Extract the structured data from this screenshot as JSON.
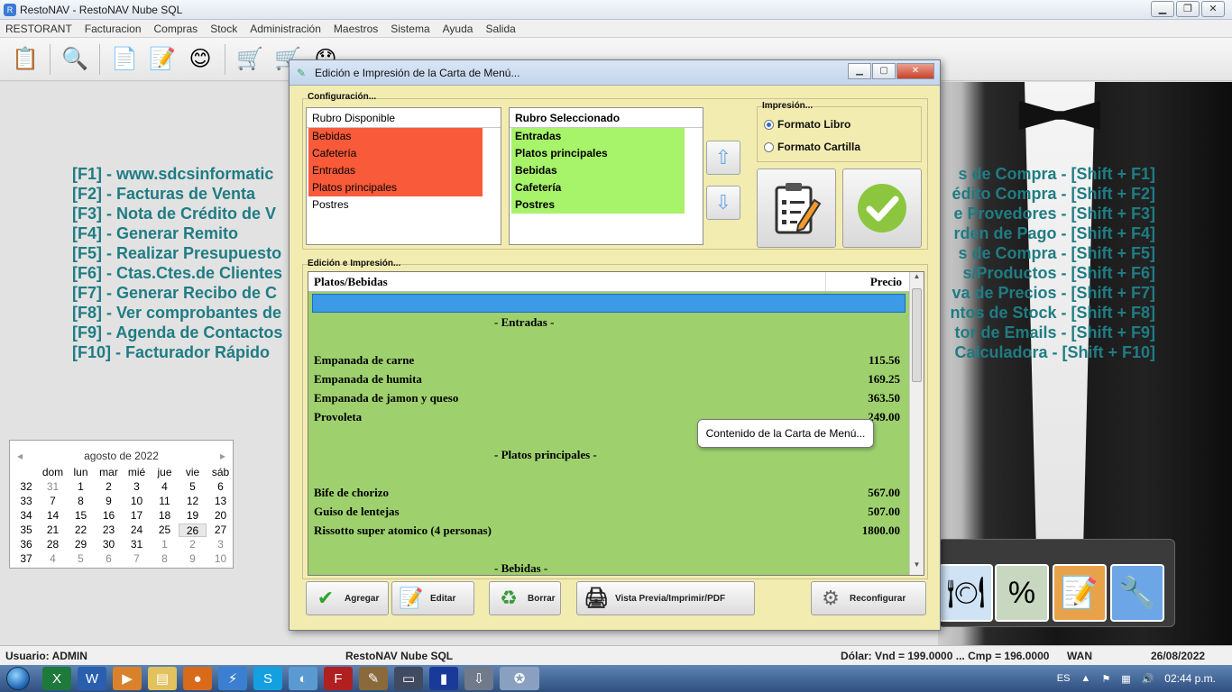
{
  "app": {
    "title": "RestoNAV - RestoNAV Nube SQL"
  },
  "menu": [
    "RESTORANT",
    "Facturacion",
    "Compras",
    "Stock",
    "Administración",
    "Maestros",
    "Sistema",
    "Ayuda",
    "Salida"
  ],
  "shortcuts_left": [
    "[F1] - www.sdcsinformatic",
    "[F2] - Facturas de Venta",
    "[F3] - Nota de Crédito de V",
    "[F4] - Generar Remito",
    "[F5] - Realizar Presupuesto",
    "[F6] - Ctas.Ctes.de Clientes",
    "[F7] - Generar Recibo de C",
    "[F8] - Ver comprobantes de",
    "[F9] - Agenda de Contactos",
    "[F10] - Facturador Rápido"
  ],
  "shortcuts_right": [
    "s de Compra - [Shift + F1]",
    "édito Compra - [Shift + F2]",
    "e Provedores - [Shift + F3]",
    "rden de Pago - [Shift + F4]",
    "s de Compra - [Shift + F5]",
    "s/Productos - [Shift + F6]",
    "va de Precios - [Shift + F7]",
    "ntos de Stock - [Shift + F8]",
    "tor de Emails - [Shift + F9]",
    "Calculadora - [Shift + F10]"
  ],
  "calendar": {
    "title": "agosto de 2022",
    "weekdays": [
      "dom",
      "lun",
      "mar",
      "mié",
      "jue",
      "vie",
      "sáb"
    ],
    "weeks": [
      {
        "wk": "32",
        "days": [
          "31",
          "1",
          "2",
          "3",
          "4",
          "5",
          "6"
        ]
      },
      {
        "wk": "33",
        "days": [
          "7",
          "8",
          "9",
          "10",
          "11",
          "12",
          "13"
        ]
      },
      {
        "wk": "34",
        "days": [
          "14",
          "15",
          "16",
          "17",
          "18",
          "19",
          "20"
        ]
      },
      {
        "wk": "35",
        "days": [
          "21",
          "22",
          "23",
          "24",
          "25",
          "26",
          "27"
        ]
      },
      {
        "wk": "36",
        "days": [
          "28",
          "29",
          "30",
          "31",
          "1",
          "2",
          "3"
        ]
      },
      {
        "wk": "37",
        "days": [
          "4",
          "5",
          "6",
          "7",
          "8",
          "9",
          "10"
        ]
      }
    ]
  },
  "dialog": {
    "title": "Edición e Impresión de la Carta de Menú...",
    "config_label": "Configuración...",
    "available": {
      "header": "Rubro Disponible",
      "items": [
        "Bebidas",
        "Cafetería",
        "Entradas",
        "Platos principales"
      ],
      "plain": "Postres"
    },
    "selected": {
      "header": "Rubro Seleccionado",
      "items": [
        "Entradas",
        "Platos principales",
        "Bebidas",
        "Cafetería",
        "Postres"
      ]
    },
    "print_label": "Impresión...",
    "format_book": "Formato Libro",
    "format_card": "Formato Cartilla",
    "edit_label": "Edición e Impresión...",
    "grid": {
      "col_name": "Platos/Bebidas",
      "col_price": "Precio",
      "sections": [
        {
          "title": "- Entradas -",
          "rows": [
            {
              "name": "Empanada de carne",
              "price": "115.56"
            },
            {
              "name": "Empanada de humita",
              "price": "169.25"
            },
            {
              "name": "Empanada de jamon y queso",
              "price": "363.50"
            },
            {
              "name": "Provoleta",
              "price": "249.00"
            }
          ]
        },
        {
          "title": "- Platos principales -",
          "rows": [
            {
              "name": "Bife de chorizo",
              "price": "567.00"
            },
            {
              "name": "Guiso de lentejas",
              "price": "507.00"
            },
            {
              "name": "Rissotto super atomico (4 personas)",
              "price": "1800.00"
            }
          ]
        },
        {
          "title": "- Bebidas -",
          "rows": []
        }
      ]
    },
    "tooltip": "Contenido de la Carta de Menú...",
    "buttons": {
      "add": "Agregar",
      "edit": "Editar",
      "delete": "Borrar",
      "preview": "Vista Previa/Imprimir/PDF",
      "reconfig": "Reconfigurar"
    }
  },
  "status": {
    "user": "Usuario: ADMIN",
    "app": "RestoNAV Nube SQL",
    "dollar": "Dólar: Vnd = 199.0000 ... Cmp = 196.0000",
    "conn": "WAN",
    "date": "26/08/2022"
  },
  "tray": {
    "lang": "ES",
    "time": "02:44 p.m."
  }
}
